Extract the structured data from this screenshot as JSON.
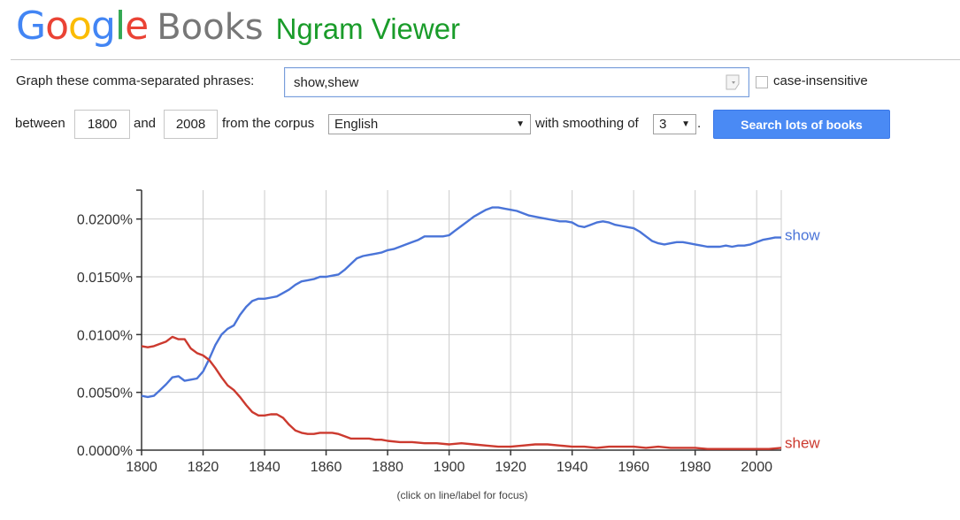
{
  "header": {
    "logo_google_letters": [
      "G",
      "o",
      "o",
      "g",
      "l",
      "e"
    ],
    "logo_google_colors": [
      "#4285F4",
      "#EA4335",
      "#FBBC05",
      "#4285F4",
      "#34A853",
      "#EA4335"
    ],
    "logo_books": "Books",
    "app_title": "Ngram Viewer"
  },
  "form": {
    "phrases_label": "Graph these comma-separated phrases:",
    "phrases_value": "show,shew",
    "case_insensitive_label": "case-insensitive",
    "case_insensitive_checked": false,
    "between_label": "between",
    "year_start": "1800",
    "and_label": "and",
    "year_end": "2008",
    "corpus_label": "from the corpus",
    "corpus_value": "English",
    "smoothing_label": "with smoothing of",
    "smoothing_value": "3",
    "period": ".",
    "search_button": "Search lots of books",
    "dropdown_arrow": "▼"
  },
  "chart_caption": "(click on line/label for focus)",
  "colors": {
    "show": "#4a74d8",
    "shew": "#cc3a2f",
    "grid": "#cccccc",
    "button": "#4a8af4"
  },
  "chart_data": {
    "type": "line",
    "title": "",
    "xlabel": "",
    "ylabel": "",
    "xlim": [
      1800,
      2008
    ],
    "ylim": [
      0,
      0.0225
    ],
    "x_ticks": [
      1800,
      1820,
      1840,
      1860,
      1880,
      1900,
      1920,
      1940,
      1960,
      1980,
      2000
    ],
    "x_tick_labels": [
      "1800",
      "1820",
      "1840",
      "1860",
      "1880",
      "1900",
      "1920",
      "1940",
      "1960",
      "1980",
      "2000"
    ],
    "y_ticks": [
      0,
      0.005,
      0.01,
      0.015,
      0.02
    ],
    "y_tick_labels": [
      "0.0000%",
      "0.0050%",
      "0.0100%",
      "0.0150%",
      "0.0200%"
    ],
    "grid": true,
    "legend": "inline labels at right end of lines",
    "series": [
      {
        "name": "show",
        "color": "#4a74d8",
        "x": [
          1800,
          1802,
          1804,
          1806,
          1808,
          1810,
          1812,
          1814,
          1816,
          1818,
          1820,
          1822,
          1824,
          1826,
          1828,
          1830,
          1832,
          1834,
          1836,
          1838,
          1840,
          1842,
          1844,
          1846,
          1848,
          1850,
          1852,
          1854,
          1856,
          1858,
          1860,
          1862,
          1864,
          1866,
          1868,
          1870,
          1872,
          1874,
          1876,
          1878,
          1880,
          1882,
          1884,
          1886,
          1888,
          1890,
          1892,
          1894,
          1896,
          1898,
          1900,
          1902,
          1904,
          1906,
          1908,
          1910,
          1912,
          1914,
          1916,
          1918,
          1920,
          1922,
          1924,
          1926,
          1928,
          1930,
          1932,
          1934,
          1936,
          1938,
          1940,
          1942,
          1944,
          1946,
          1948,
          1950,
          1952,
          1954,
          1956,
          1958,
          1960,
          1962,
          1964,
          1966,
          1968,
          1970,
          1972,
          1974,
          1976,
          1978,
          1980,
          1982,
          1984,
          1986,
          1988,
          1990,
          1992,
          1994,
          1996,
          1998,
          2000,
          2002,
          2004,
          2006,
          2008
        ],
        "y": [
          0.0047,
          0.0046,
          0.0047,
          0.0052,
          0.0057,
          0.0063,
          0.0064,
          0.006,
          0.0061,
          0.0062,
          0.0068,
          0.0079,
          0.0091,
          0.01,
          0.0105,
          0.0108,
          0.0117,
          0.0124,
          0.0129,
          0.0131,
          0.0131,
          0.0132,
          0.0133,
          0.0136,
          0.0139,
          0.0143,
          0.0146,
          0.0147,
          0.0148,
          0.015,
          0.015,
          0.0151,
          0.0152,
          0.0156,
          0.0161,
          0.0166,
          0.0168,
          0.0169,
          0.017,
          0.0171,
          0.0173,
          0.0174,
          0.0176,
          0.0178,
          0.018,
          0.0182,
          0.0185,
          0.0185,
          0.0185,
          0.0185,
          0.0186,
          0.019,
          0.0194,
          0.0198,
          0.0202,
          0.0205,
          0.0208,
          0.021,
          0.021,
          0.0209,
          0.0208,
          0.0207,
          0.0205,
          0.0203,
          0.0202,
          0.0201,
          0.02,
          0.0199,
          0.0198,
          0.0198,
          0.0197,
          0.0194,
          0.0193,
          0.0195,
          0.0197,
          0.0198,
          0.0197,
          0.0195,
          0.0194,
          0.0193,
          0.0192,
          0.0189,
          0.0185,
          0.0181,
          0.0179,
          0.0178,
          0.0179,
          0.018,
          0.018,
          0.0179,
          0.0178,
          0.0177,
          0.0176,
          0.0176,
          0.0176,
          0.0177,
          0.0176,
          0.0177,
          0.0177,
          0.0178,
          0.018,
          0.0182,
          0.0183,
          0.0184,
          0.0184
        ]
      },
      {
        "name": "shew",
        "color": "#cc3a2f",
        "x": [
          1800,
          1802,
          1804,
          1806,
          1808,
          1810,
          1812,
          1814,
          1816,
          1818,
          1820,
          1822,
          1824,
          1826,
          1828,
          1830,
          1832,
          1834,
          1836,
          1838,
          1840,
          1842,
          1844,
          1846,
          1848,
          1850,
          1852,
          1854,
          1856,
          1858,
          1860,
          1862,
          1864,
          1866,
          1868,
          1870,
          1872,
          1874,
          1876,
          1878,
          1880,
          1884,
          1888,
          1892,
          1896,
          1900,
          1904,
          1908,
          1912,
          1916,
          1920,
          1924,
          1928,
          1932,
          1936,
          1940,
          1944,
          1948,
          1952,
          1956,
          1960,
          1964,
          1968,
          1972,
          1976,
          1980,
          1984,
          1988,
          1992,
          1996,
          2000,
          2004,
          2008
        ],
        "y": [
          0.009,
          0.0089,
          0.009,
          0.0092,
          0.0094,
          0.0098,
          0.0096,
          0.0096,
          0.0088,
          0.0084,
          0.0082,
          0.0078,
          0.0071,
          0.0063,
          0.0056,
          0.0052,
          0.0046,
          0.0039,
          0.0033,
          0.003,
          0.003,
          0.0031,
          0.0031,
          0.0028,
          0.0022,
          0.0017,
          0.0015,
          0.0014,
          0.0014,
          0.0015,
          0.0015,
          0.0015,
          0.0014,
          0.0012,
          0.001,
          0.001,
          0.001,
          0.001,
          0.0009,
          0.0009,
          0.0008,
          0.0007,
          0.0007,
          0.0006,
          0.0006,
          0.0005,
          0.0006,
          0.0005,
          0.0004,
          0.0003,
          0.0003,
          0.0004,
          0.0005,
          0.0005,
          0.0004,
          0.0003,
          0.0003,
          0.0002,
          0.0003,
          0.0003,
          0.0003,
          0.0002,
          0.0003,
          0.0002,
          0.0002,
          0.0002,
          0.0001,
          0.0001,
          0.0001,
          0.0001,
          0.0001,
          0.0001,
          0.0002
        ]
      }
    ]
  }
}
